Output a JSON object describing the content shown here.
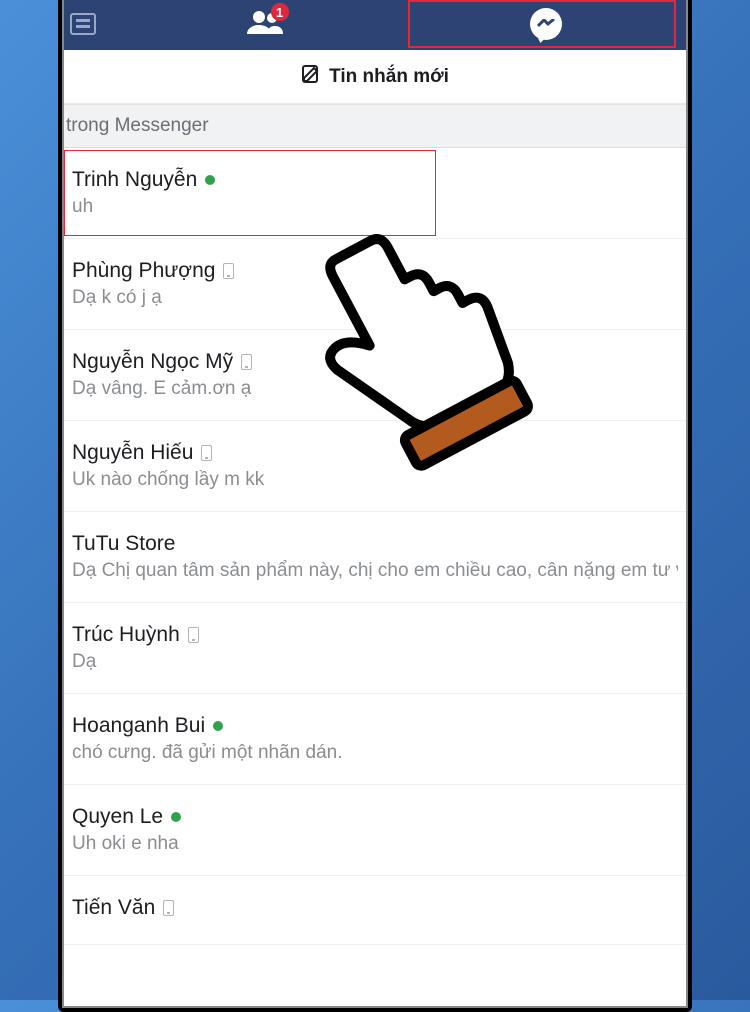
{
  "topbar": {
    "friend_badge": "1"
  },
  "compose": {
    "label": "Tin nhắn mới"
  },
  "search": {
    "text": " trong Messenger"
  },
  "conversations": [
    {
      "name": "Trinh Nguyễn",
      "status": "online",
      "preview": "uh",
      "highlight": true
    },
    {
      "name": "Phùng Phượng",
      "status": "mobile",
      "preview": "Dạ k có j ạ"
    },
    {
      "name": "Nguyễn Ngọc Mỹ",
      "status": "mobile",
      "preview": "Dạ vâng. E cảm.ơn ạ"
    },
    {
      "name": "Nguyễn Hiếu",
      "status": "mobile",
      "preview": "Uk nào chống lầy m kk"
    },
    {
      "name": "TuTu Store",
      "status": "none",
      "preview": "Dạ Chị quan tâm sản phẩm này, chị cho em chiều cao, cân nặng em tư v"
    },
    {
      "name": "Trúc Huỳnh",
      "status": "mobile",
      "preview": "Dạ"
    },
    {
      "name": "Hoanganh Bui",
      "status": "online",
      "preview": "chó cưng. đã gửi một nhãn dán."
    },
    {
      "name": "Quyen Le",
      "status": "online",
      "preview": "Uh oki e nha"
    },
    {
      "name": "Tiến Văn",
      "status": "mobile",
      "preview": ""
    }
  ]
}
